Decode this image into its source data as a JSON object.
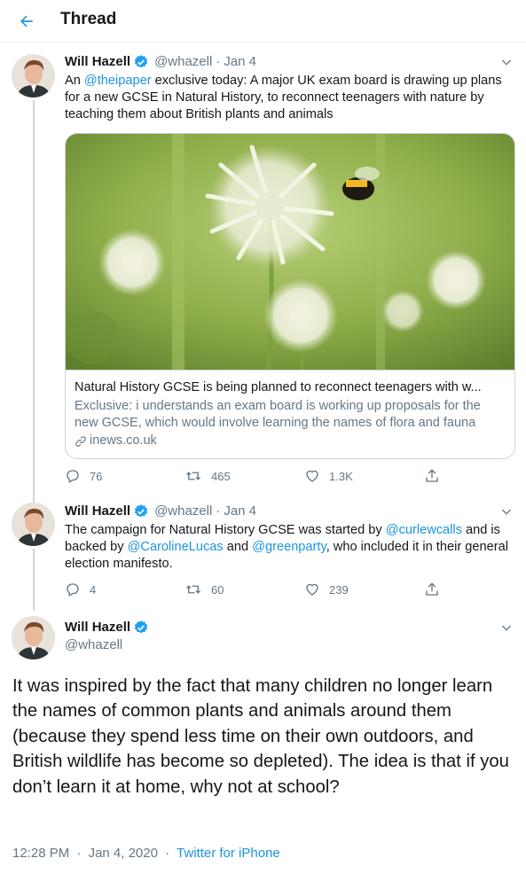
{
  "header": {
    "title": "Thread",
    "back_icon": "arrow-left-icon"
  },
  "colors": {
    "accent": "#1b95e0",
    "muted": "#657786",
    "border": "#ccd6dd",
    "verified": "#1da1f2"
  },
  "tweets": [
    {
      "name": "Will Hazell",
      "handle": "@whazell",
      "date": "Jan 4",
      "text_parts": [
        "An ",
        "@theipaper",
        " exclusive today: A major UK exam board is drawing up plans for a new GCSE in Natural History, to reconnect teenagers with nature by teaching them about British plants and animals"
      ],
      "card": {
        "title": "Natural History GCSE is being planned to reconnect teenagers with w...",
        "description": "Exclusive: i understands an exam board is working up proposals for the new GCSE, which would involve learning the names of flora and fauna",
        "domain": "inews.co.uk"
      },
      "replies": "76",
      "retweets": "465",
      "likes": "1.3K"
    },
    {
      "name": "Will Hazell",
      "handle": "@whazell",
      "date": "Jan 4",
      "text_parts": [
        "The campaign for Natural History GCSE was started by ",
        "@curlewcalls",
        " and is backed by ",
        "@CarolineLucas",
        " and ",
        "@greenparty",
        ", who included it in their general election manifesto."
      ],
      "replies": "4",
      "retweets": "60",
      "likes": "239"
    },
    {
      "name": "Will Hazell",
      "handle": "@whazell",
      "text": "It was inspired by the fact that many children no longer learn the names of common plants and animals around them (because they spend less time on their own outdoors, and British wildlife has become so depleted). The idea is that if you don’t learn it at home, why not at school?",
      "time": "12:28 PM",
      "full_date": "Jan 4, 2020",
      "source": "Twitter for iPhone"
    }
  ]
}
